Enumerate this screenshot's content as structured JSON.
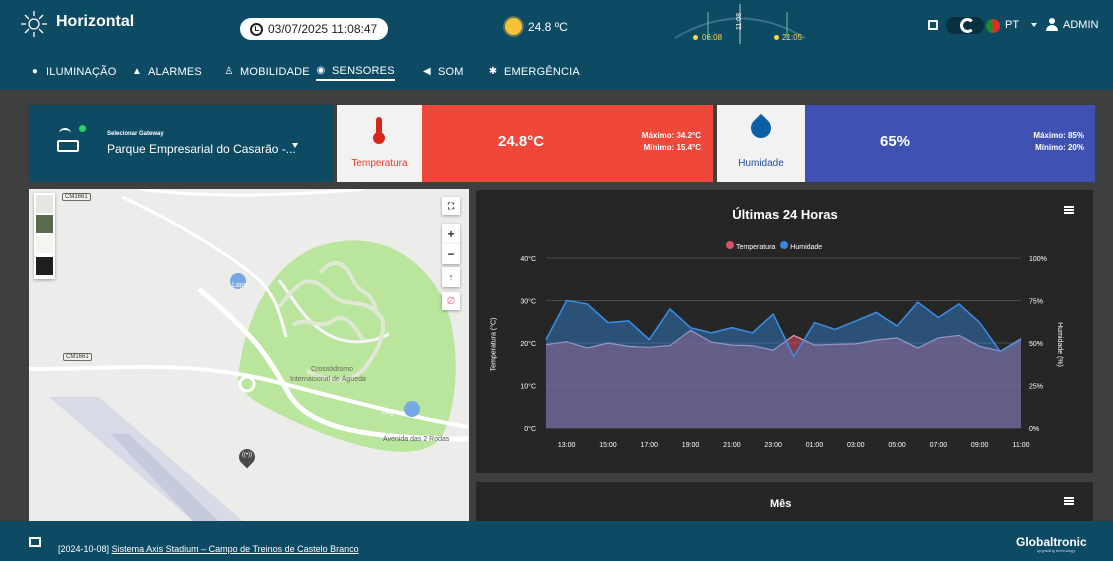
{
  "header": {
    "app_title": "Horizontal",
    "datetime": "03/07/2025 11:08:47",
    "weather_temp": "24.8 ºC",
    "sunrise": "06:08",
    "sunset": "21:05",
    "vertical_time": "11:08",
    "language": "PT",
    "user": "ADMIN"
  },
  "nav": {
    "items": [
      {
        "label": "ILUMINAÇÃO",
        "icon": "lightbulb-icon"
      },
      {
        "label": "ALARMES",
        "icon": "bell-icon"
      },
      {
        "label": "MOBILIDADE",
        "icon": "walking-person-icon"
      },
      {
        "label": "SENSORES",
        "icon": "sensor-icon",
        "active": true
      },
      {
        "label": "SOM",
        "icon": "speaker-icon"
      },
      {
        "label": "EMERGÊNCIA",
        "icon": "asterisk-icon"
      }
    ]
  },
  "gateway": {
    "label": "Selecionar Gateway",
    "value": "Parque Empresarial do Casarão -..."
  },
  "temperature": {
    "label": "Temperatura",
    "value": "24.8°C",
    "max": "Máximo: 34.2°C",
    "min": "Mínimo: 15.4°C",
    "color": "#f0473b"
  },
  "humidity": {
    "label": "Humidade",
    "value": "65%",
    "max": "Máximo: 85%",
    "min": "Mínimo: 20%",
    "color": "#3f52b3"
  },
  "map": {
    "labels": [
      "Lago",
      "Lago",
      "Crossódromo",
      "Internacional de Águeda",
      "Avenida das 2 Rodas"
    ],
    "road_shields": [
      "CM1661",
      "CM1661"
    ],
    "controls": [
      "fullscreen-icon",
      "zoom-in-icon",
      "zoom-out-icon",
      "compass-icon"
    ]
  },
  "chart_data": [
    {
      "type": "area",
      "title": "Últimas 24 Horas",
      "legend": [
        "Temperatura",
        "Humidade"
      ],
      "x": [
        "12:00",
        "13:00",
        "14:00",
        "15:00",
        "16:00",
        "17:00",
        "18:00",
        "19:00",
        "20:00",
        "21:00",
        "22:00",
        "23:00",
        "00:00",
        "01:00",
        "02:00",
        "03:00",
        "04:00",
        "05:00",
        "06:00",
        "07:00",
        "08:00",
        "09:00",
        "10:00",
        "11:00"
      ],
      "x_ticks": [
        "13:00",
        "15:00",
        "17:00",
        "19:00",
        "21:00",
        "23:00",
        "01:00",
        "03:00",
        "05:00",
        "07:00",
        "09:00",
        "11:00"
      ],
      "series": [
        {
          "name": "Temperatura",
          "axis": "left",
          "color": "#d85061",
          "values": [
            19.6,
            20.3,
            18.8,
            20.0,
            19.2,
            19.0,
            19.4,
            23.0,
            20.2,
            19.5,
            19.4,
            18.3,
            21.8,
            19.5,
            19.7,
            19.8,
            20.7,
            21.2,
            18.8,
            21.2,
            21.8,
            19.2,
            18.1,
            21.0
          ]
        },
        {
          "name": "Humidade",
          "axis": "right",
          "color": "#3687d9",
          "values": [
            52,
            75,
            73,
            62,
            63,
            52,
            70,
            59,
            56,
            59,
            56,
            67,
            42,
            62,
            58,
            63,
            68,
            60,
            74,
            65,
            73,
            62,
            45,
            52
          ]
        }
      ],
      "ylabel": "Temperatura (°C)",
      "ylabel_right": "Humidade (%)",
      "y_left_ticks": [
        "0°C",
        "10°C",
        "20°C",
        "30°C",
        "40°C"
      ],
      "y_right_ticks": [
        "0%",
        "25%",
        "50%",
        "75%",
        "100%"
      ],
      "ylim": [
        0,
        40
      ],
      "ylim_right": [
        0,
        100
      ]
    },
    {
      "type": "bar",
      "title": "Mês"
    }
  ],
  "footer": {
    "prefix": "[2024-10-08]",
    "link": "Sistema Axis Stadium – Campo de Treinos de Castelo Branco",
    "brand": "Globaltronic",
    "tagline": "upgrading technology"
  }
}
